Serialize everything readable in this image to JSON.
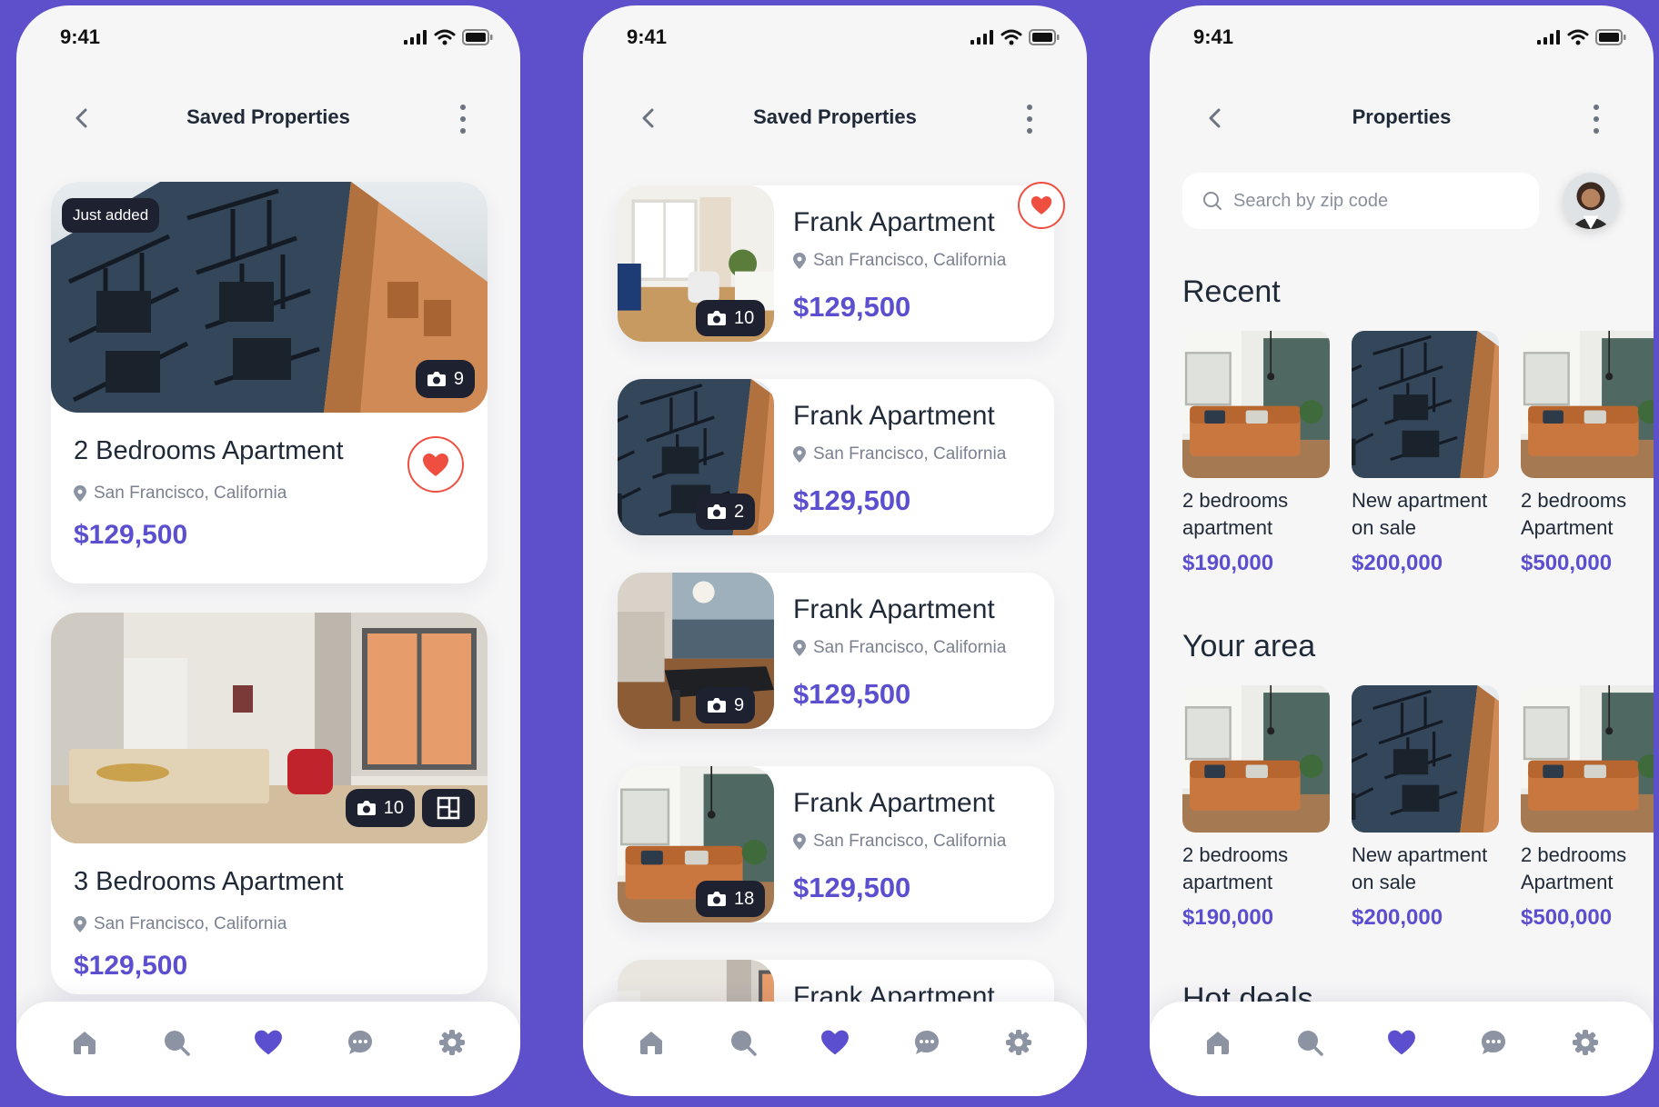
{
  "status": {
    "time": "9:41"
  },
  "screens": {
    "saved_grid": {
      "title": "Saved Properties",
      "cards": [
        {
          "badge": "Just added",
          "photo_count": "9",
          "title": "2 Bedrooms Apartment",
          "location": "San Francisco, California",
          "price": "$129,500",
          "favorited": true
        },
        {
          "photo_count": "10",
          "title": "3 Bedrooms Apartment",
          "location": "San Francisco, California",
          "price": "$129,500"
        }
      ]
    },
    "saved_list": {
      "title": "Saved Properties",
      "items": [
        {
          "title": "Frank Apartment",
          "location": "San Francisco, California",
          "price": "$129,500",
          "photo_count": "10",
          "favorited": true
        },
        {
          "title": "Frank Apartment",
          "location": "San Francisco, California",
          "price": "$129,500",
          "photo_count": "2"
        },
        {
          "title": "Frank Apartment",
          "location": "San Francisco, California",
          "price": "$129,500",
          "photo_count": "9"
        },
        {
          "title": "Frank Apartment",
          "location": "San Francisco, California",
          "price": "$129,500",
          "photo_count": "18"
        },
        {
          "title": "Frank Apartment"
        }
      ]
    },
    "properties": {
      "title": "Properties",
      "search_placeholder": "Search by zip code",
      "sections": [
        {
          "title": "Recent",
          "items": [
            {
              "title": "2 bedrooms apartment",
              "price": "$190,000"
            },
            {
              "title": "New apartment on sale",
              "price": "$200,000"
            },
            {
              "title": "2 bedrooms Apartment",
              "price": "$500,000"
            }
          ]
        },
        {
          "title": "Your area",
          "items": [
            {
              "title": "2 bedrooms apartment",
              "price": "$190,000"
            },
            {
              "title": "New apartment on sale",
              "price": "$200,000"
            },
            {
              "title": "2 bedrooms Apartment",
              "price": "$500,000"
            }
          ]
        },
        {
          "title": "Hot deals"
        }
      ]
    }
  },
  "tabbar": {
    "icons": [
      "home-icon",
      "search-icon",
      "heart-icon",
      "chat-icon",
      "gear-icon"
    ],
    "active": "heart-icon"
  },
  "colors": {
    "accent": "#5b4fcf",
    "background": "#5e50cb",
    "heart": "#ef4f40",
    "inactive_icon": "#8c93a3"
  }
}
